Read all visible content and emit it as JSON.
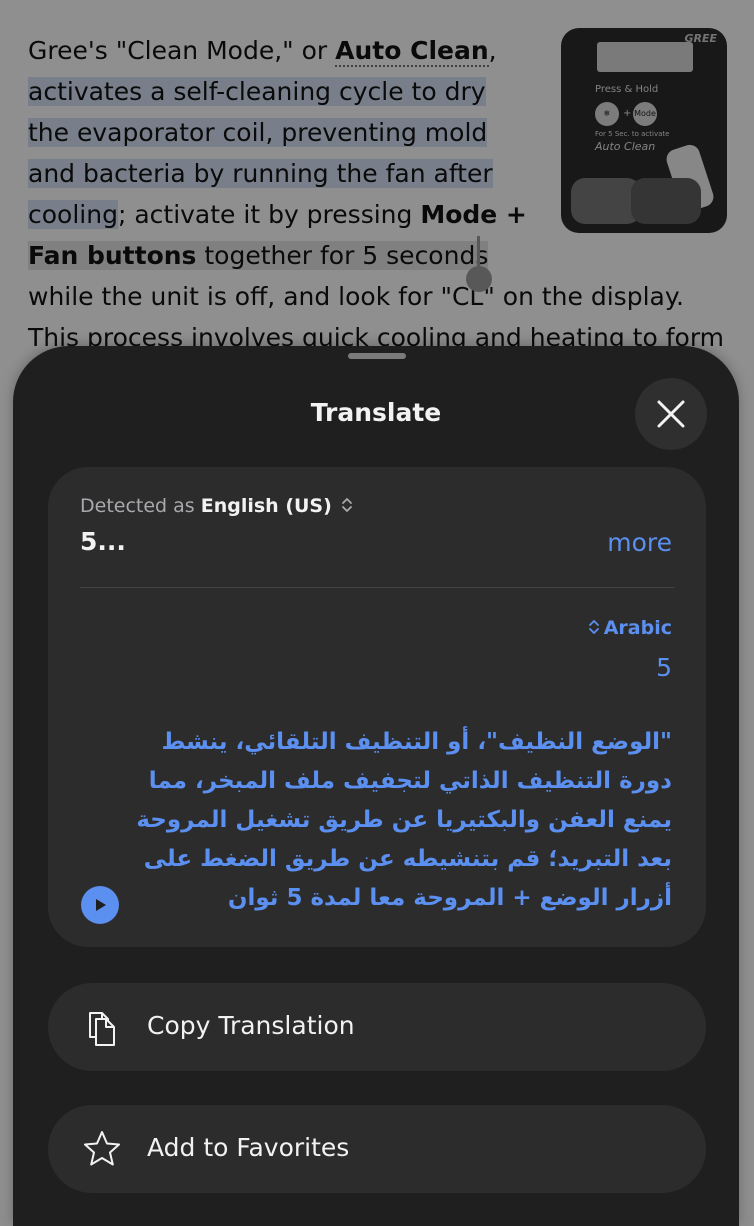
{
  "article": {
    "lines": [
      {
        "a": "Gree's \"Clean Mode,\" or ",
        "b": "Auto Clean",
        "c": ","
      },
      {
        "hl": " activates a self-cleaning cycle to dry"
      },
      {
        "hl": "the evaporator coil, preventing mold"
      },
      {
        "hl": "and bacteria by running the fan after"
      },
      {
        "hl": "cooling",
        "a": "; activate it by pressing ",
        "b": "Mode +"
      },
      {
        "b": "Fan buttons",
        "a": " together for 5 seconds"
      },
      {
        "a": "while the unit is off, and look for \"CL\" on the display."
      },
      {
        "a": "This process involves quick cooling and heating to form"
      }
    ],
    "thumbnail": {
      "brand": "GREE",
      "press_hold": "Press & Hold",
      "mode": "Mode",
      "for_5_sec": "For 5 Sec. to activate",
      "auto_clean": "Auto Clean"
    }
  },
  "sheet": {
    "title": "Translate",
    "close_icon": "xmark-icon",
    "detected_prefix": "Detected as",
    "detected_language": "English (US)",
    "source_text": "5...",
    "more_label": "more",
    "target_language": "Arabic",
    "target_number": "5",
    "translation_lines": [
      "\"الوضع النظيف\"، أو التنظيف التلقائي، ينشط",
      "دورة التنظيف الذاتي لتجفيف ملف المبخر، مما",
      "يمنع العفن والبكتيريا عن طريق تشغيل المروحة",
      "بعد التبريد؛ قم بتنشيطه عن طريق الضغط على",
      "أزرار الوضع + المروحة معا لمدة 5 ثوان"
    ],
    "actions": [
      {
        "label": "Copy Translation",
        "icon": "copy-icon"
      },
      {
        "label": "Add to Favorites",
        "icon": "star-icon"
      }
    ]
  },
  "colors": {
    "accent": "#5b8ff0",
    "sheet_bg": "#1f1f1f",
    "card_bg": "#2c2c2d"
  }
}
